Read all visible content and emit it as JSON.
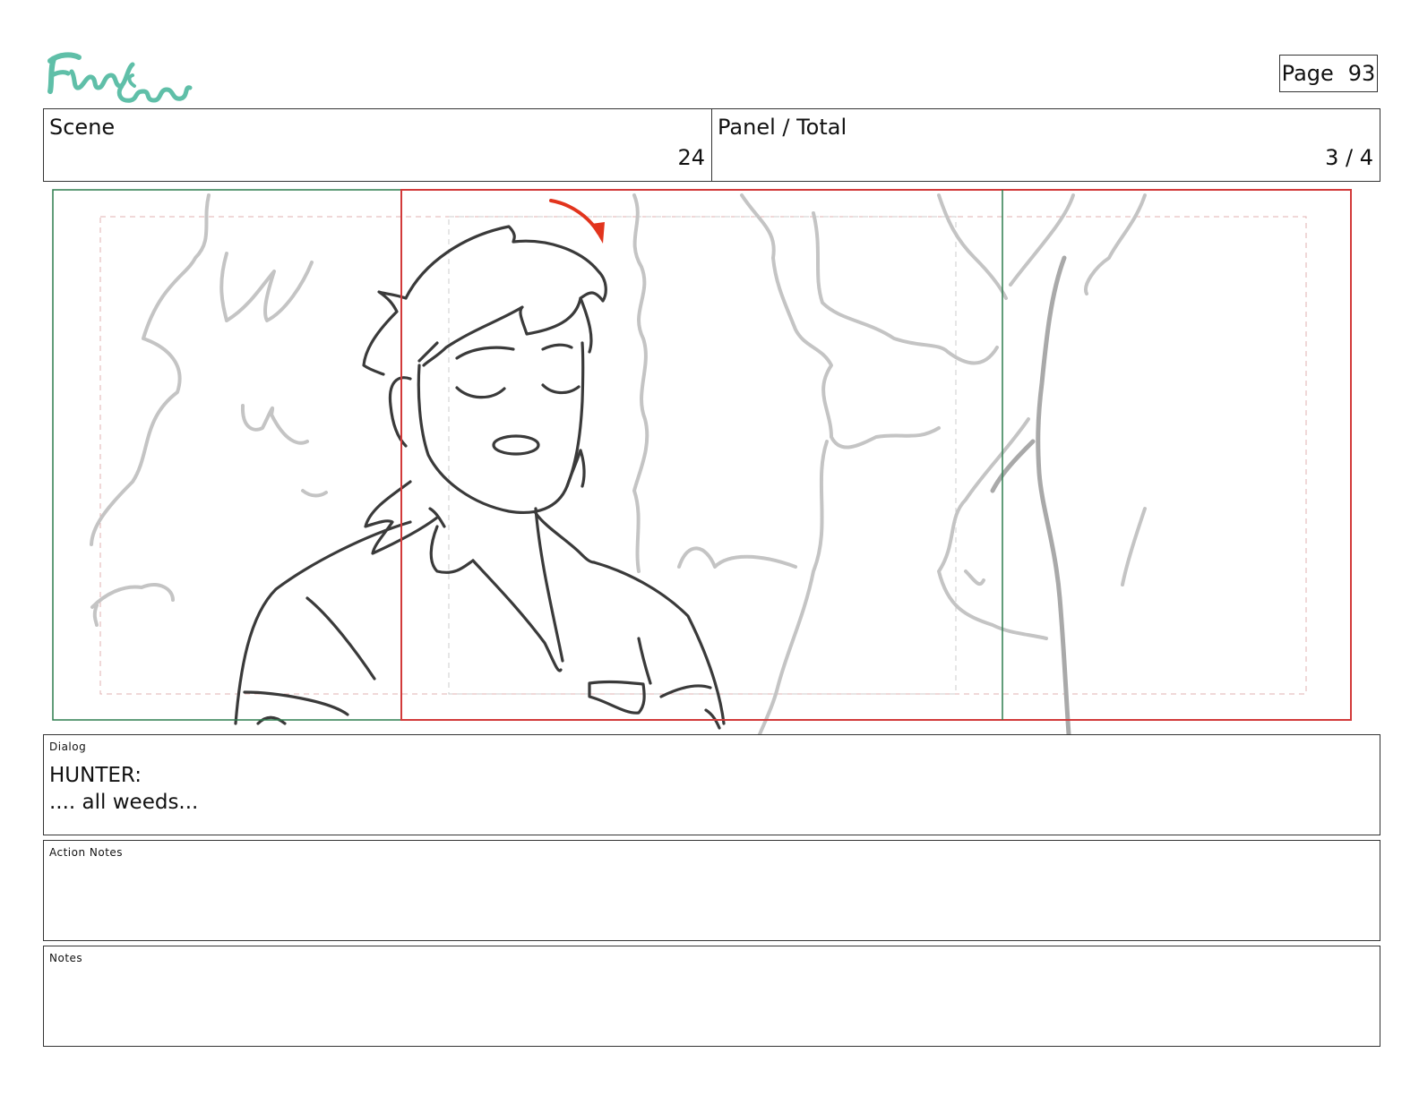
{
  "header": {
    "logo_text": "Fionna and Cake",
    "page_label": "Page",
    "page_number": "93"
  },
  "scene": {
    "label": "Scene",
    "value": "24"
  },
  "panel": {
    "label": "Panel / Total",
    "value": "3 / 4"
  },
  "dialog": {
    "label": "Dialog",
    "lines": [
      "HUNTER:",
      ".... all weeds..."
    ]
  },
  "action_notes": {
    "label": "Action Notes",
    "text": ""
  },
  "notes": {
    "label": "Notes",
    "text": ""
  },
  "colors": {
    "frame_green": "#2e7d4f",
    "frame_red": "#d23a3a",
    "arrow_red": "#e2341d",
    "logo_teal": "#5fbfa8"
  }
}
